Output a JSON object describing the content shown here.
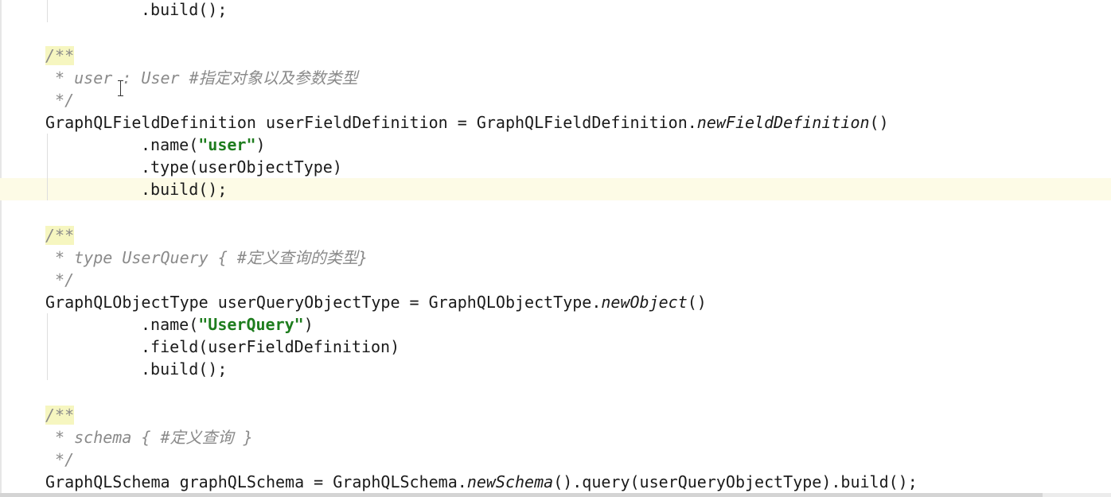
{
  "editor": {
    "lines": {
      "l1_build": ".build();",
      "c1_open": "/**",
      "c1_body": " * user : User #指定对象以及参数类型",
      "c1_close": " */",
      "d1_decl_a": "GraphQLFieldDefinition userFieldDefinition = GraphQLFieldDefinition.",
      "d1_decl_call": "newFieldDefinition",
      "d1_decl_b": "()",
      "d1_name_a": ".name(",
      "d1_name_str": "\"user\"",
      "d1_name_b": ")",
      "d1_type": ".type(userObjectType)",
      "d1_build": ".build();",
      "c2_open": "/**",
      "c2_body": " * type UserQuery { #定义查询的类型}",
      "c2_close": " */",
      "d2_decl_a": "GraphQLObjectType userQueryObjectType = GraphQLObjectType.",
      "d2_decl_call": "newObject",
      "d2_decl_b": "()",
      "d2_name_a": ".name(",
      "d2_name_str": "\"UserQuery\"",
      "d2_name_b": ")",
      "d2_field": ".field(userFieldDefinition)",
      "d2_build": ".build();",
      "c3_open": "/**",
      "c3_body": " * schema { #定义查询 }",
      "c3_close": " */",
      "d3_decl_a": "GraphQLSchema graphQLSchema = GraphQLSchema.",
      "d3_decl_call": "newSchema",
      "d3_decl_b": "().query(userQueryObjectType).build();"
    }
  }
}
